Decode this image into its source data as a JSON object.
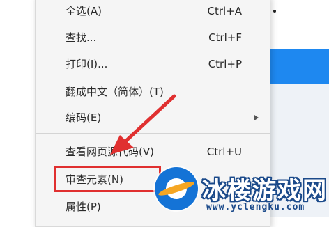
{
  "menu": {
    "items": [
      {
        "label": "全选(A)",
        "shortcut": "Ctrl+A"
      },
      {
        "label": "查找...",
        "shortcut": "Ctrl+F"
      },
      {
        "label": "打印(I)...",
        "shortcut": "Ctrl+P"
      },
      {
        "label": "翻成中文（简体）(T)",
        "shortcut": ""
      },
      {
        "label": "编码(E)",
        "shortcut": "",
        "has_submenu": true
      },
      {
        "label": "查看网页源代码(V)",
        "shortcut": "Ctrl+U"
      },
      {
        "label": "审查元素(N)",
        "shortcut": "",
        "highlighted": true
      },
      {
        "label": "属性(P)",
        "shortcut": ""
      }
    ]
  },
  "annotation": {
    "color": "#e03030"
  },
  "watermark": {
    "title": "冰楼游戏网",
    "url": "www.yclengku.com"
  },
  "colors": {
    "menu_bg": "#f5f5f5",
    "accent_blue": "#1e88f0",
    "highlight_red": "#e03030"
  }
}
